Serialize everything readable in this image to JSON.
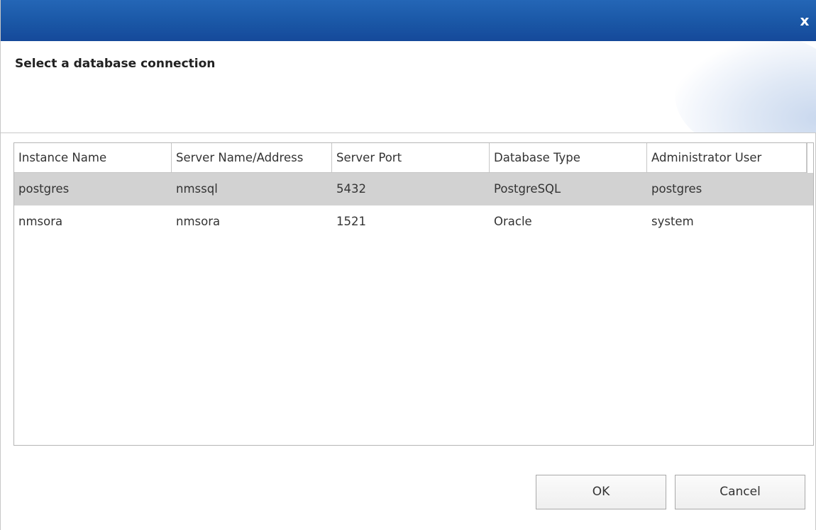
{
  "titlebar": {
    "close_label": "x",
    "close_icon": "close-icon",
    "color": "#1a57a6"
  },
  "header": {
    "title": "Select a database connection"
  },
  "table": {
    "columns": [
      "Instance Name",
      "Server Name/Address",
      "Server Port",
      "Database Type",
      "Administrator User"
    ],
    "rows": [
      {
        "instance": "postgres",
        "server": "nmssql",
        "port": "5432",
        "type": "PostgreSQL",
        "admin": "postgres",
        "selected": true
      },
      {
        "instance": "nmsora",
        "server": "nmsora",
        "port": "1521",
        "type": "Oracle",
        "admin": "system",
        "selected": false
      }
    ],
    "selected_row_color": "#d2d2d2"
  },
  "buttons": {
    "ok_label": "OK",
    "cancel_label": "Cancel"
  }
}
